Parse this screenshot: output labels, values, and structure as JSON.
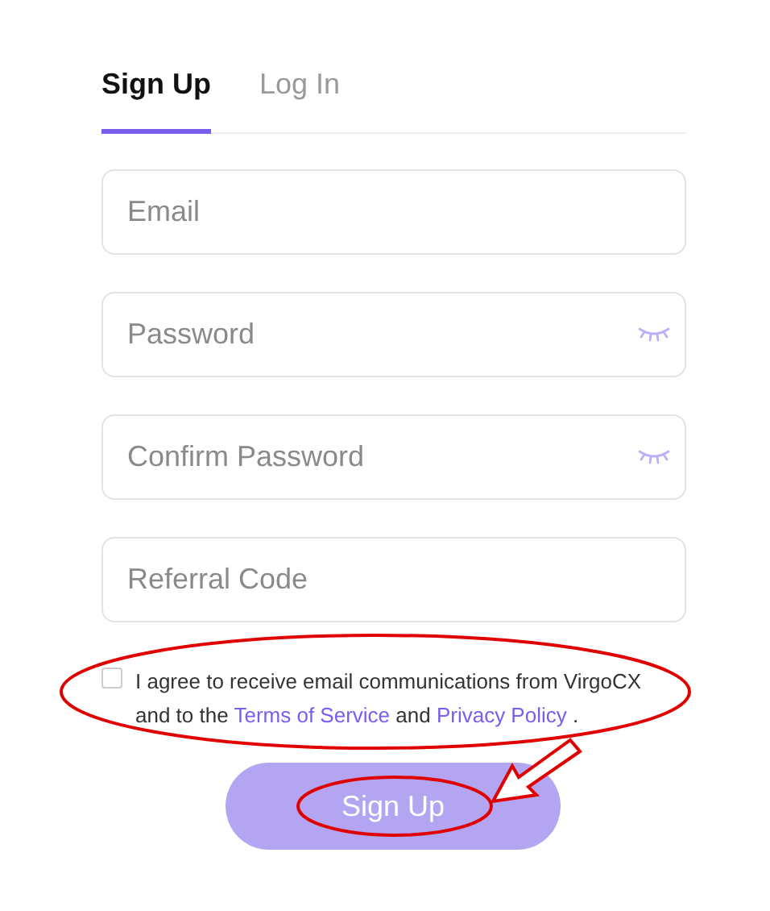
{
  "tabs": [
    {
      "label": "Sign Up",
      "selected": true
    },
    {
      "label": "Log In",
      "selected": false
    }
  ],
  "fields": [
    {
      "placeholder": "Email",
      "kind": "text"
    },
    {
      "placeholder": "Password",
      "kind": "password"
    },
    {
      "placeholder": "Confirm Password",
      "kind": "password"
    },
    {
      "placeholder": "Referral Code",
      "kind": "text"
    }
  ],
  "consent": {
    "checked": false,
    "highlighted": true,
    "text_before": "I agree to receive email communications from VirgoCX and to the",
    "link_1": "Terms of Service",
    "text_middle": "and",
    "link_2": "Privacy Policy",
    "text_after": "."
  },
  "submit": {
    "label": "Sign Up",
    "disabled": true,
    "highlighted": true,
    "pointer_arrow": true
  }
}
